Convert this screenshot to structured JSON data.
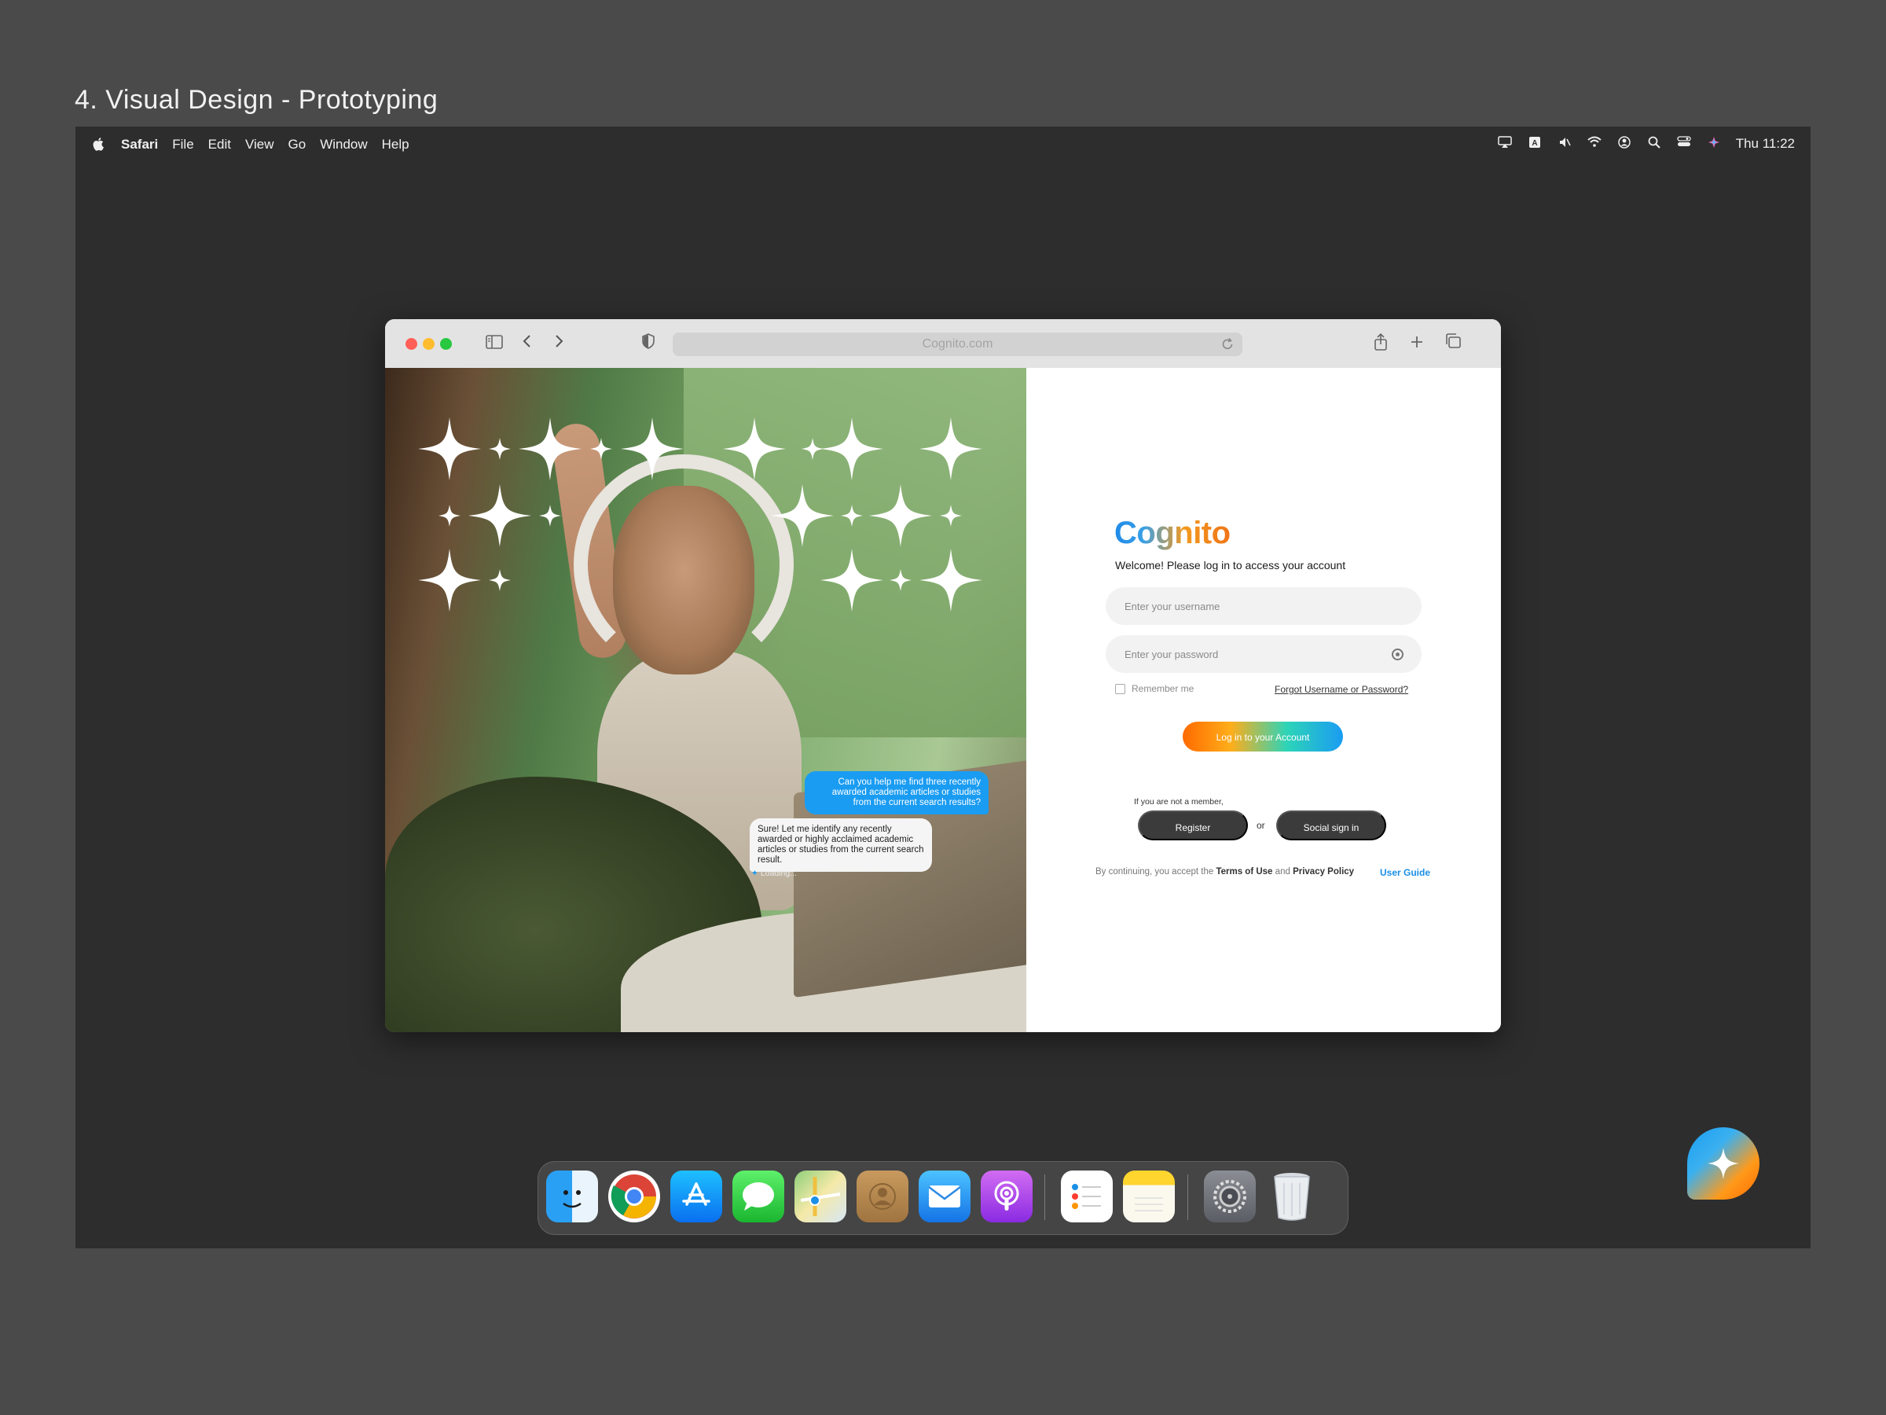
{
  "slide_title": "4. Visual Design - Prototyping",
  "menubar": {
    "app": "Safari",
    "menus": [
      "File",
      "Edit",
      "View",
      "Go",
      "Window",
      "Help"
    ],
    "clock": "Thu 11:22"
  },
  "browser": {
    "url": "Cognito.com"
  },
  "chat": {
    "question": "Can you help me find three recently awarded academic articles or studies from the current search results?",
    "answer": "Sure! Let me identify any recently awarded or highly acclaimed academic articles or studies from the current search result.",
    "loading": "Loading..."
  },
  "login": {
    "logo": "Cognito",
    "welcome": "Welcome! Please log in to access your account",
    "username_placeholder": "Enter your username",
    "password_placeholder": "Enter your password",
    "remember": "Remember me",
    "forgot": "Forgot Username or Password?",
    "login_button": "Log in to your Account",
    "not_member": "If you are not a member,",
    "register": "Register",
    "or": "or",
    "social": "Social sign in",
    "legal_prefix": "By continuing, you accept the",
    "terms": "Terms of Use",
    "and": "and",
    "privacy": "Privacy Policy",
    "user_guide": "User Guide"
  },
  "dock": {
    "icons": [
      "finder-icon",
      "chrome-icon",
      "app-store-icon",
      "messages-icon",
      "maps-icon",
      "contacts-icon",
      "mail-icon",
      "podcasts-icon",
      "reminders-icon",
      "notes-icon",
      "system-settings-icon",
      "trash-icon"
    ]
  },
  "colors": {
    "accent": "#1a9cf2",
    "brand_orange": "#ff6a00",
    "dark_button": "#3b3b3b"
  }
}
